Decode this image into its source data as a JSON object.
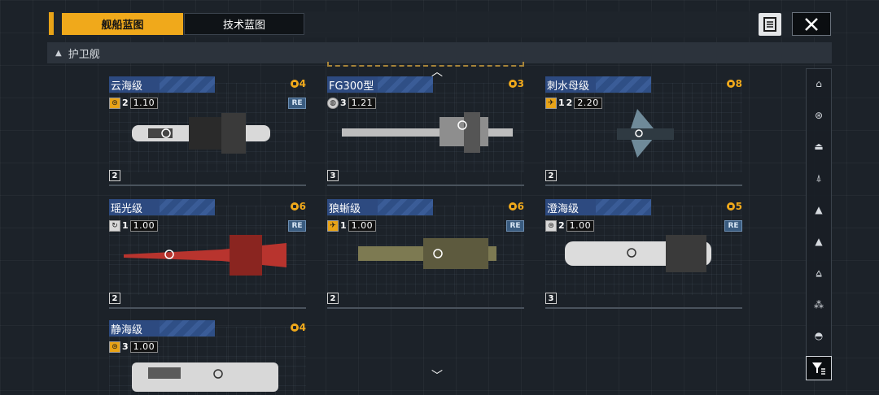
{
  "tabs": {
    "ship_blueprints": "舰船蓝图",
    "tech_blueprints": "技术蓝图"
  },
  "section": {
    "title": "护卫舰"
  },
  "cards": [
    {
      "name": "云海级",
      "cost": "4",
      "stat_count": "2",
      "stat_value": "1.10",
      "re": "RE",
      "slot": "2",
      "accent": "#d9d9d9"
    },
    {
      "name": "FG300型",
      "cost": "3",
      "stat_count": "3",
      "stat_value": "1.21",
      "re": "",
      "slot": "3",
      "accent": "#cfcfcf"
    },
    {
      "name": "刺水母级",
      "cost": "8",
      "stat_count": "1",
      "stat_count2": "2",
      "stat_value": "2.20",
      "re": "",
      "slot": "2",
      "accent": "#9fb8c8"
    },
    {
      "name": "瑶光级",
      "cost": "6",
      "stat_count": "1",
      "stat_value": "1.00",
      "re": "RE",
      "slot": "2",
      "accent": "#c23a34"
    },
    {
      "name": "狼蜥级",
      "cost": "6",
      "stat_count": "1",
      "stat_value": "1.00",
      "re": "RE",
      "slot": "2",
      "accent": "#8a8a5a"
    },
    {
      "name": "澄海级",
      "cost": "5",
      "stat_count": "2",
      "stat_value": "1.00",
      "re": "RE",
      "slot": "3",
      "accent": "#e2e2e2"
    },
    {
      "name": "静海级",
      "cost": "4",
      "stat_count": "3",
      "stat_value": "1.00",
      "re": "",
      "slot": "",
      "accent": "#d8d8d8"
    }
  ],
  "sidebar_icons": [
    "tower-icon",
    "ring-ship-icon",
    "carrier-icon",
    "destroyer-icon",
    "frigate-icon",
    "corvette-icon",
    "fighter-icon",
    "squad-icon",
    "dome-icon"
  ],
  "colors": {
    "accent": "#f0a91b",
    "name_bar": "#2f4f86",
    "background": "#1c2229"
  }
}
